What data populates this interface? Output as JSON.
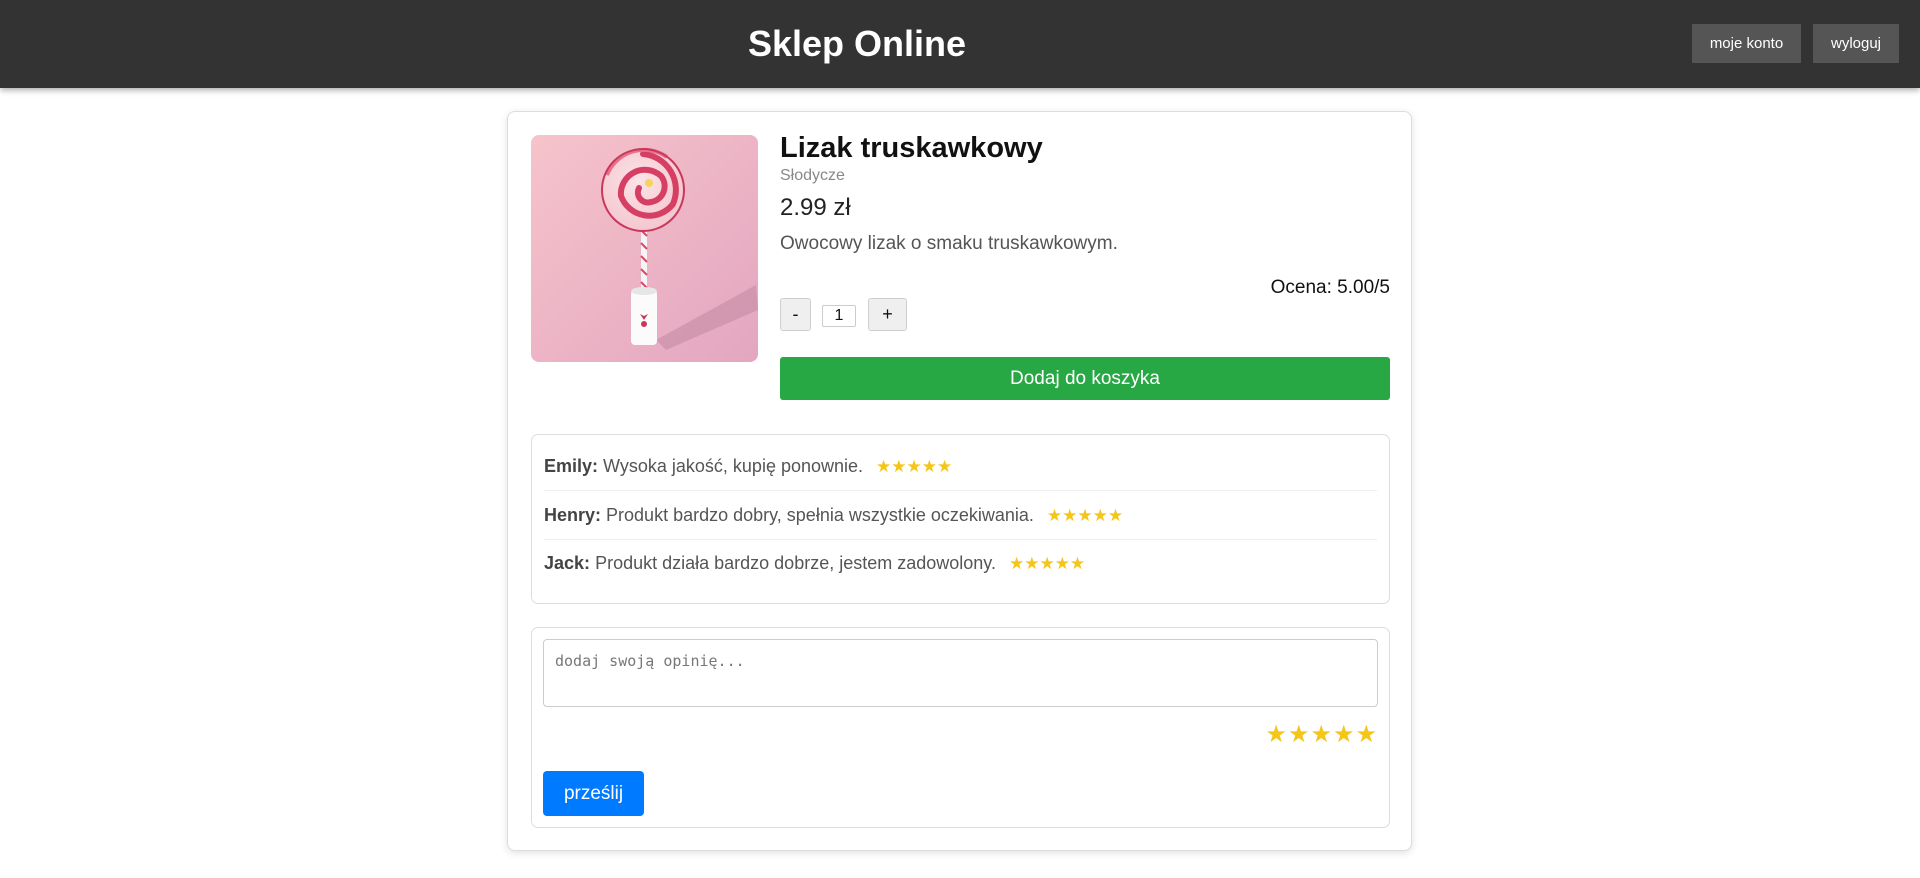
{
  "header": {
    "title": "Sklep Online",
    "account_label": "moje konto",
    "logout_label": "wyloguj"
  },
  "product": {
    "name": "Lizak truskawkowy",
    "category": "Słodycze",
    "price": "2.99 zł",
    "description": "Owocowy lizak o smaku truskawkowym.",
    "rating": "Ocena: 5.00/5",
    "rating_value": 5.0,
    "quantity": "1",
    "minus_label": "-",
    "plus_label": "+",
    "add_to_cart_label": "Dodaj do koszyka"
  },
  "reviews": [
    {
      "author": "Emily:",
      "text": "Wysoka jakość, kupię ponownie.",
      "stars": "★★★★★",
      "rating": 5
    },
    {
      "author": "Henry:",
      "text": "Produkt bardzo dobry, spełnia wszystkie oczekiwania.",
      "stars": "★★★★★",
      "rating": 5
    },
    {
      "author": "Jack:",
      "text": "Produkt działa bardzo dobrze, jestem zadowolony.",
      "stars": "★★★★★",
      "rating": 5
    }
  ],
  "review_form": {
    "placeholder": "dodaj swoją opinię...",
    "stars": "★★★★★",
    "submit_label": "prześlij"
  },
  "colors": {
    "header_bg": "#333333",
    "nav_button_bg": "#555555",
    "add_to_cart": "#28a745",
    "submit": "#007bff",
    "star": "#f5c518"
  }
}
